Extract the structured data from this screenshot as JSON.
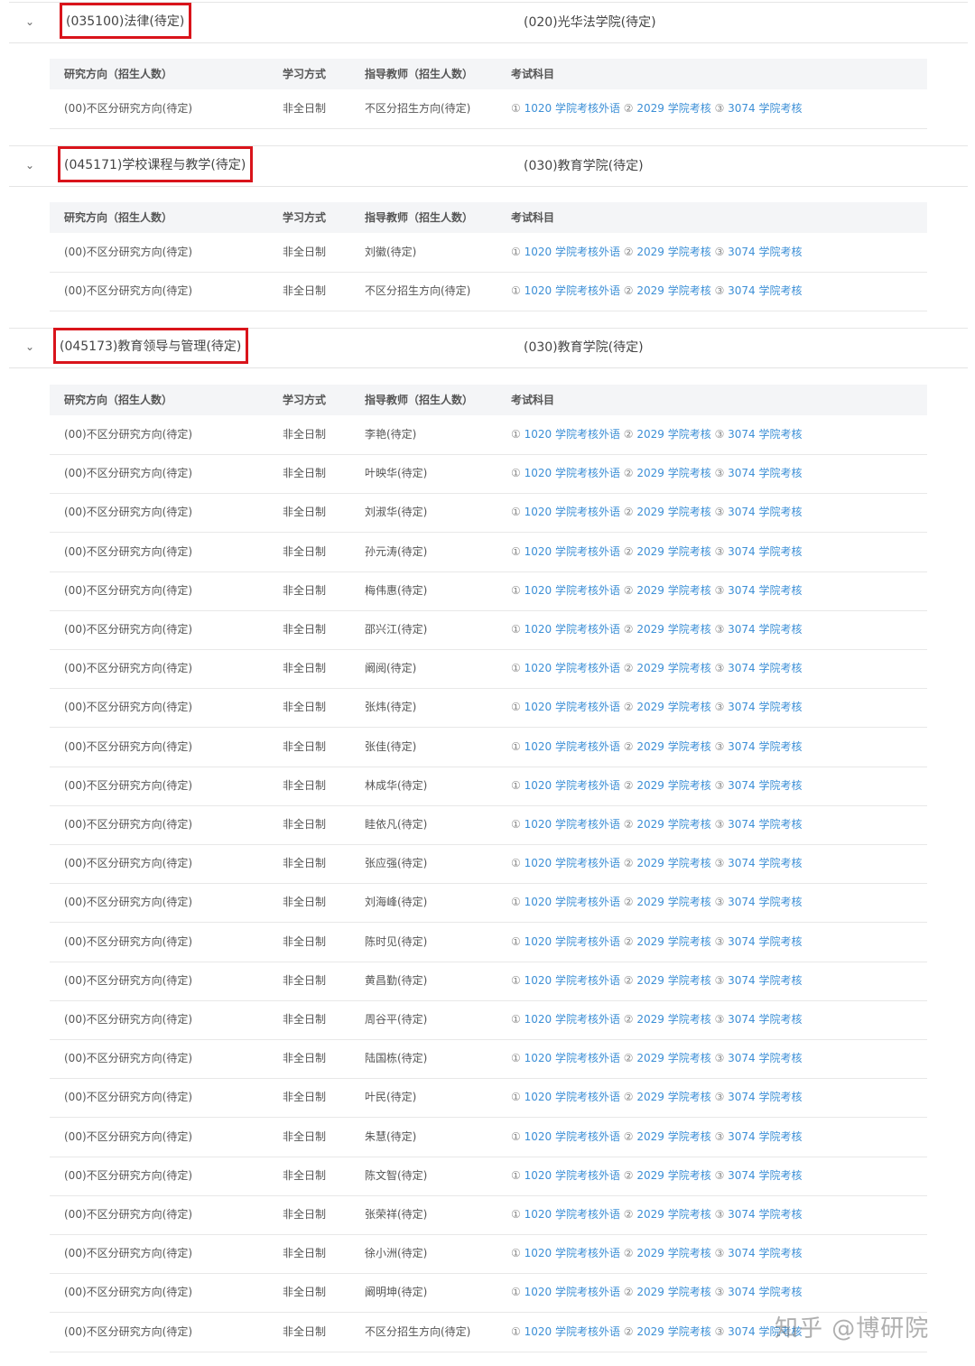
{
  "table_headers": {
    "direction": "研究方向（招生人数）",
    "mode": "学习方式",
    "advisor": "指导教师（招生人数）",
    "exam": "考试科目"
  },
  "exam_idx": [
    "①",
    "②",
    "③"
  ],
  "exam_subjects": [
    "1020 学院考核外语",
    "2029 学院考核",
    "3074 学院考核"
  ],
  "majors": [
    {
      "name": "(035100)法律(待定)",
      "college": "(020)光华法学院(待定)",
      "rows": [
        {
          "direction": "(00)不区分研究方向(待定)",
          "mode": "非全日制",
          "advisor": "不区分招生方向(待定)"
        }
      ]
    },
    {
      "name": "(045171)学校课程与教学(待定)",
      "college": "(030)教育学院(待定)",
      "rows": [
        {
          "direction": "(00)不区分研究方向(待定)",
          "mode": "非全日制",
          "advisor": "刘徽(待定)"
        },
        {
          "direction": "(00)不区分研究方向(待定)",
          "mode": "非全日制",
          "advisor": "不区分招生方向(待定)"
        }
      ]
    },
    {
      "name": "(045173)教育领导与管理(待定)",
      "college": "(030)教育学院(待定)",
      "rows": [
        {
          "direction": "(00)不区分研究方向(待定)",
          "mode": "非全日制",
          "advisor": "李艳(待定)"
        },
        {
          "direction": "(00)不区分研究方向(待定)",
          "mode": "非全日制",
          "advisor": "叶映华(待定)"
        },
        {
          "direction": "(00)不区分研究方向(待定)",
          "mode": "非全日制",
          "advisor": "刘淑华(待定)"
        },
        {
          "direction": "(00)不区分研究方向(待定)",
          "mode": "非全日制",
          "advisor": "孙元涛(待定)"
        },
        {
          "direction": "(00)不区分研究方向(待定)",
          "mode": "非全日制",
          "advisor": "梅伟惠(待定)"
        },
        {
          "direction": "(00)不区分研究方向(待定)",
          "mode": "非全日制",
          "advisor": "邵兴江(待定)"
        },
        {
          "direction": "(00)不区分研究方向(待定)",
          "mode": "非全日制",
          "advisor": "阚阅(待定)"
        },
        {
          "direction": "(00)不区分研究方向(待定)",
          "mode": "非全日制",
          "advisor": "张炜(待定)"
        },
        {
          "direction": "(00)不区分研究方向(待定)",
          "mode": "非全日制",
          "advisor": "张佳(待定)"
        },
        {
          "direction": "(00)不区分研究方向(待定)",
          "mode": "非全日制",
          "advisor": "林成华(待定)"
        },
        {
          "direction": "(00)不区分研究方向(待定)",
          "mode": "非全日制",
          "advisor": "眭依凡(待定)"
        },
        {
          "direction": "(00)不区分研究方向(待定)",
          "mode": "非全日制",
          "advisor": "张应强(待定)"
        },
        {
          "direction": "(00)不区分研究方向(待定)",
          "mode": "非全日制",
          "advisor": "刘海峰(待定)"
        },
        {
          "direction": "(00)不区分研究方向(待定)",
          "mode": "非全日制",
          "advisor": "陈时见(待定)"
        },
        {
          "direction": "(00)不区分研究方向(待定)",
          "mode": "非全日制",
          "advisor": "黄昌勤(待定)"
        },
        {
          "direction": "(00)不区分研究方向(待定)",
          "mode": "非全日制",
          "advisor": "周谷平(待定)"
        },
        {
          "direction": "(00)不区分研究方向(待定)",
          "mode": "非全日制",
          "advisor": "陆国栋(待定)"
        },
        {
          "direction": "(00)不区分研究方向(待定)",
          "mode": "非全日制",
          "advisor": "叶民(待定)"
        },
        {
          "direction": "(00)不区分研究方向(待定)",
          "mode": "非全日制",
          "advisor": "朱慧(待定)"
        },
        {
          "direction": "(00)不区分研究方向(待定)",
          "mode": "非全日制",
          "advisor": "陈文智(待定)"
        },
        {
          "direction": "(00)不区分研究方向(待定)",
          "mode": "非全日制",
          "advisor": "张荣祥(待定)"
        },
        {
          "direction": "(00)不区分研究方向(待定)",
          "mode": "非全日制",
          "advisor": "徐小洲(待定)"
        },
        {
          "direction": "(00)不区分研究方向(待定)",
          "mode": "非全日制",
          "advisor": "阚明坤(待定)"
        },
        {
          "direction": "(00)不区分研究方向(待定)",
          "mode": "非全日制",
          "advisor": "不区分招生方向(待定)"
        }
      ]
    }
  ],
  "watermark": "知乎 @博研院",
  "colors": {
    "highlight": "#d9141b",
    "link": "#3c8fd6",
    "header_bg": "#f4f5f7"
  }
}
